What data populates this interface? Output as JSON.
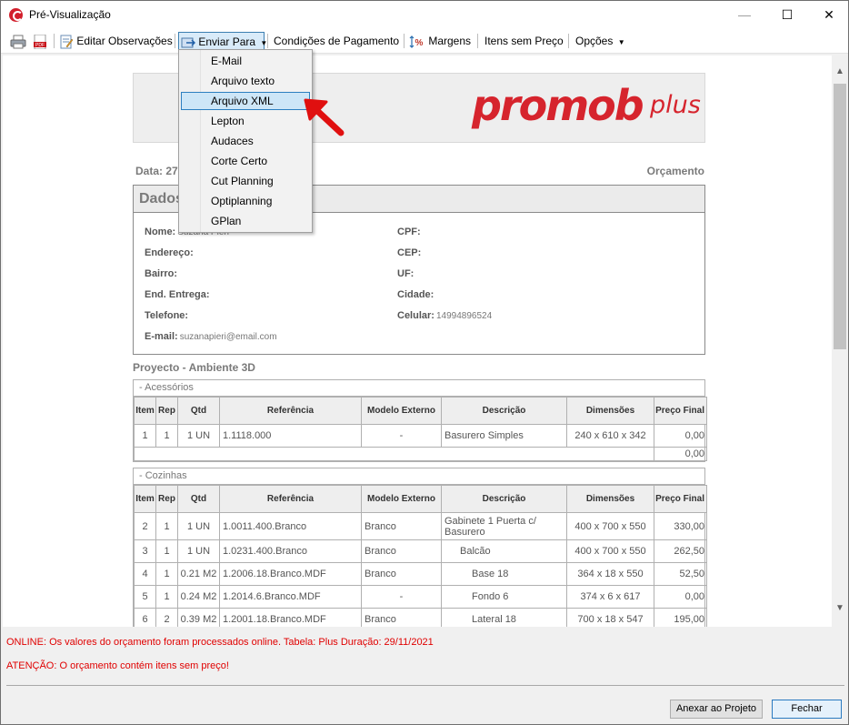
{
  "window": {
    "title": "Pré-Visualização",
    "controls": {
      "minimize": "—",
      "maximize": "☐",
      "close": "✕"
    }
  },
  "toolbar": {
    "edit_notes": "Editar Observações",
    "send_to": "Enviar Para",
    "payment_conditions": "Condições de Pagamento",
    "margins": "Margens",
    "items_no_price": "Itens sem Preço",
    "options": "Opções",
    "pdf_icon_text": "PDF"
  },
  "send_menu": {
    "items": [
      "E-Mail",
      "Arquivo texto",
      "Arquivo XML",
      "Lepton",
      "Audaces",
      "Corte Certo",
      "Cut Planning",
      "Optiplanning",
      "GPlan"
    ],
    "highlighted_index": 2
  },
  "document": {
    "logo_main": "promob",
    "logo_plus": "plus",
    "date_label": "Data: 27",
    "doc_type": "Orçamento",
    "client_header": "Dados",
    "client": {
      "name_label": "Nome:",
      "name_value": "Suzana Pieri",
      "address_label": "Endereço:",
      "district_label": "Bairro:",
      "delivery_label": "End. Entrega:",
      "phone_label": "Telefone:",
      "email_label": "E-mail:",
      "email_value": "suzanapieri@email.com",
      "cpf_label": "CPF:",
      "cep_label": "CEP:",
      "uf_label": "UF:",
      "city_label": "Cidade:",
      "mobile_label": "Celular:",
      "mobile_value": "14994896524"
    },
    "project_title": "Proyecto - Ambiente 3D",
    "columns": [
      "Item",
      "Rep",
      "Qtd",
      "Referência",
      "Modelo Externo",
      "Descrição",
      "Dimensões",
      "Preço Final"
    ],
    "groups": [
      {
        "name": "- Acessórios",
        "rows": [
          {
            "item": "1",
            "rep": "1",
            "qtd": "1 UN",
            "ref": "1.1118.000",
            "model": "-",
            "desc": "Basurero Simples",
            "dim": "240 x 610 x 342",
            "price": "0,00"
          }
        ],
        "total": "0,00"
      },
      {
        "name": "- Cozinhas",
        "rows": [
          {
            "item": "2",
            "rep": "1",
            "qtd": "1 UN",
            "ref": "1.0011.400.Branco",
            "model": "Branco",
            "desc": "Gabinete 1 Puerta c/ Basurero",
            "dim": "400 x 700 x 550",
            "price": "330,00"
          },
          {
            "item": "3",
            "rep": "1",
            "qtd": "1 UN",
            "ref": "1.0231.400.Branco",
            "model": "Branco",
            "desc": "Balcão",
            "dim": "400 x 700 x 550",
            "price": "262,50"
          },
          {
            "item": "4",
            "rep": "1",
            "qtd": "0.21 M2",
            "ref": "1.2006.18.Branco.MDF",
            "model": "Branco",
            "desc": "Base 18",
            "dim": "364 x 18 x 550",
            "price": "52,50"
          },
          {
            "item": "5",
            "rep": "1",
            "qtd": "0.24 M2",
            "ref": "1.2014.6.Branco.MDF",
            "model": "-",
            "desc": "Fondo 6",
            "dim": "374 x 6 x 617",
            "price": "0,00"
          },
          {
            "item": "6",
            "rep": "2",
            "qtd": "0.39 M2",
            "ref": "1.2001.18.Branco.MDF",
            "model": "Branco",
            "desc": "Lateral 18",
            "dim": "700 x 18 x 547",
            "price": "195,00"
          }
        ]
      }
    ]
  },
  "status": {
    "online": "ONLINE: Os valores do orçamento foram processados online. Tabela:  Plus Duração: 29/11/2021",
    "warning": "ATENÇÃO: O orçamento contém itens sem preço!"
  },
  "buttons": {
    "attach": "Anexar ao Projeto",
    "close": "Fechar"
  },
  "colors": {
    "brand_red": "#d6242d",
    "status_red": "#e00000",
    "highlight": "#cde6f7"
  }
}
